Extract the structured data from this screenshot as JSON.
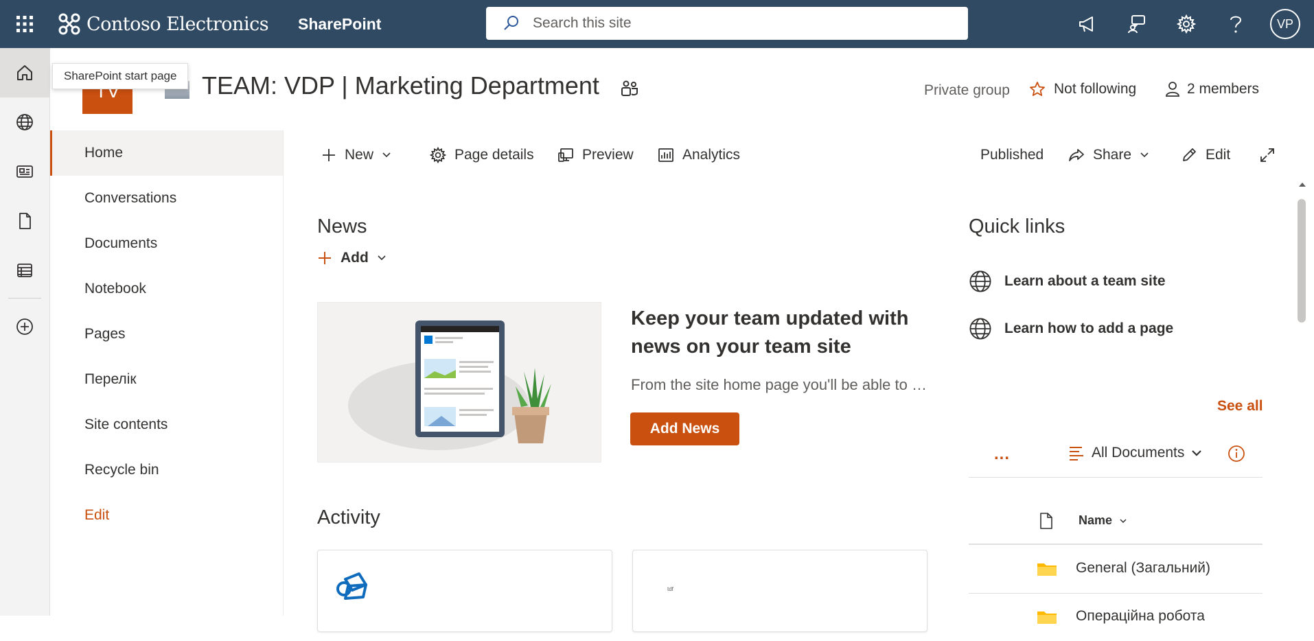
{
  "topbar": {
    "brand": "Contoso Electronics",
    "app": "SharePoint",
    "search_placeholder": "Search this site",
    "avatar_initials": "VP"
  },
  "tooltip": "SharePoint start page",
  "site": {
    "logo_initials": "TV",
    "title": "TEAM: VDP | Marketing Department",
    "privacy": "Private group",
    "follow": "Not following",
    "members": "2 members"
  },
  "nav": {
    "items": [
      "Home",
      "Conversations",
      "Documents",
      "Notebook",
      "Pages",
      "Перелік",
      "Site contents",
      "Recycle bin"
    ],
    "edit": "Edit"
  },
  "commands": {
    "new": "New",
    "page_details": "Page details",
    "preview": "Preview",
    "analytics": "Analytics",
    "status": "Published",
    "share": "Share",
    "edit": "Edit"
  },
  "news": {
    "title": "News",
    "add": "Add",
    "headline": "Keep your team updated with news on your team site",
    "description": "From the site home page you'll be able to quickly author a news post - a status update, trip report, or event recap.",
    "button": "Add News"
  },
  "activity": {
    "title": "Activity",
    "card2_tag": "tdf"
  },
  "quick_links": {
    "title": "Quick links",
    "items": [
      "Learn about a team site",
      "Learn how to add a page"
    ],
    "see_all": "See all"
  },
  "documents": {
    "more": "...",
    "view": "All Documents",
    "column_name": "Name",
    "rows": [
      "General (Загальний)",
      "Операційна робота"
    ]
  },
  "colors": {
    "topbar": "#2f4a62",
    "accent": "#ca5010"
  }
}
